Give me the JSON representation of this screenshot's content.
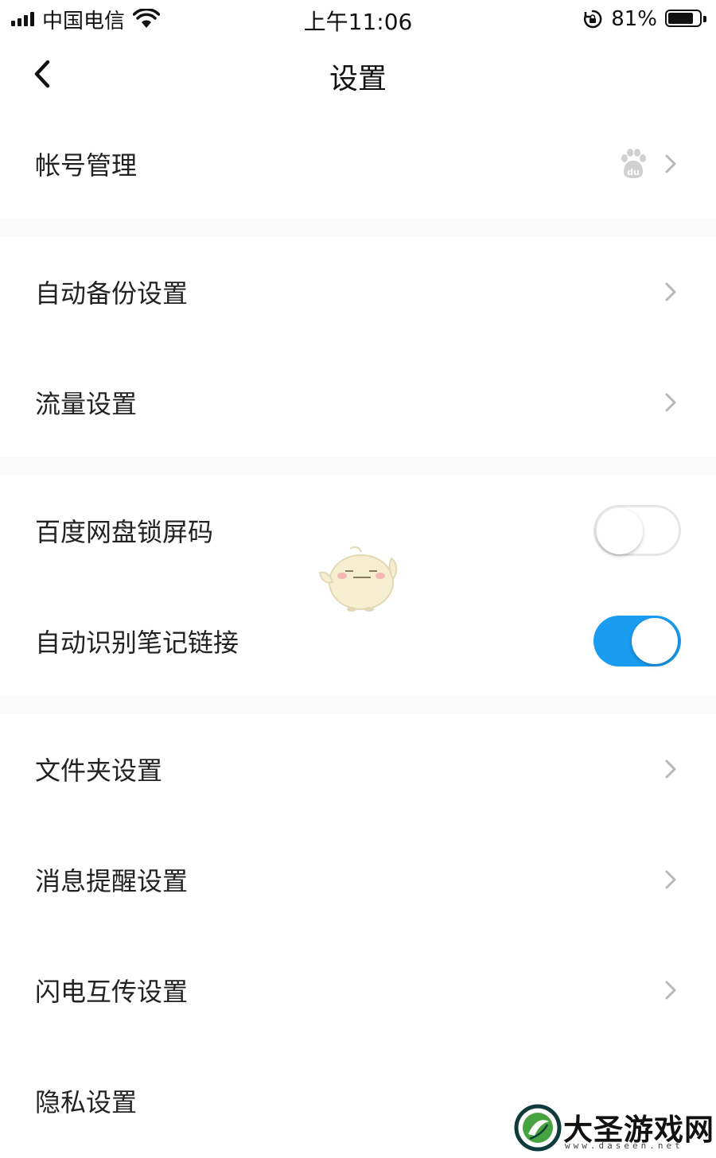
{
  "status_bar": {
    "carrier": "中国电信",
    "time": "上午11:06",
    "battery_percent": "81%",
    "battery_level": 0.81,
    "icons": [
      "signal-icon",
      "wifi-icon",
      "orientation-lock-icon",
      "battery-icon"
    ]
  },
  "nav": {
    "title": "设置",
    "back_icon": "chevron-left-icon"
  },
  "settings": {
    "account": {
      "label": "帐号管理",
      "icon": "baidu-paw-icon"
    },
    "auto_backup": {
      "label": "自动备份设置"
    },
    "traffic": {
      "label": "流量设置"
    },
    "lock_code": {
      "label": "百度网盘锁屏码",
      "enabled": false
    },
    "note_links": {
      "label": "自动识别笔记链接",
      "enabled": true
    },
    "folder": {
      "label": "文件夹设置"
    },
    "notifications": {
      "label": "消息提醒设置"
    },
    "flash_transfer": {
      "label": "闪电互传设置"
    },
    "privacy": {
      "label": "隐私设置"
    }
  },
  "colors": {
    "toggle_on": "#1a9cf0",
    "divider_bg": "#fafafa",
    "chevron": "#b8b8b8"
  },
  "watermark": {
    "name": "大圣游戏网",
    "url": "www.daseen.net"
  }
}
